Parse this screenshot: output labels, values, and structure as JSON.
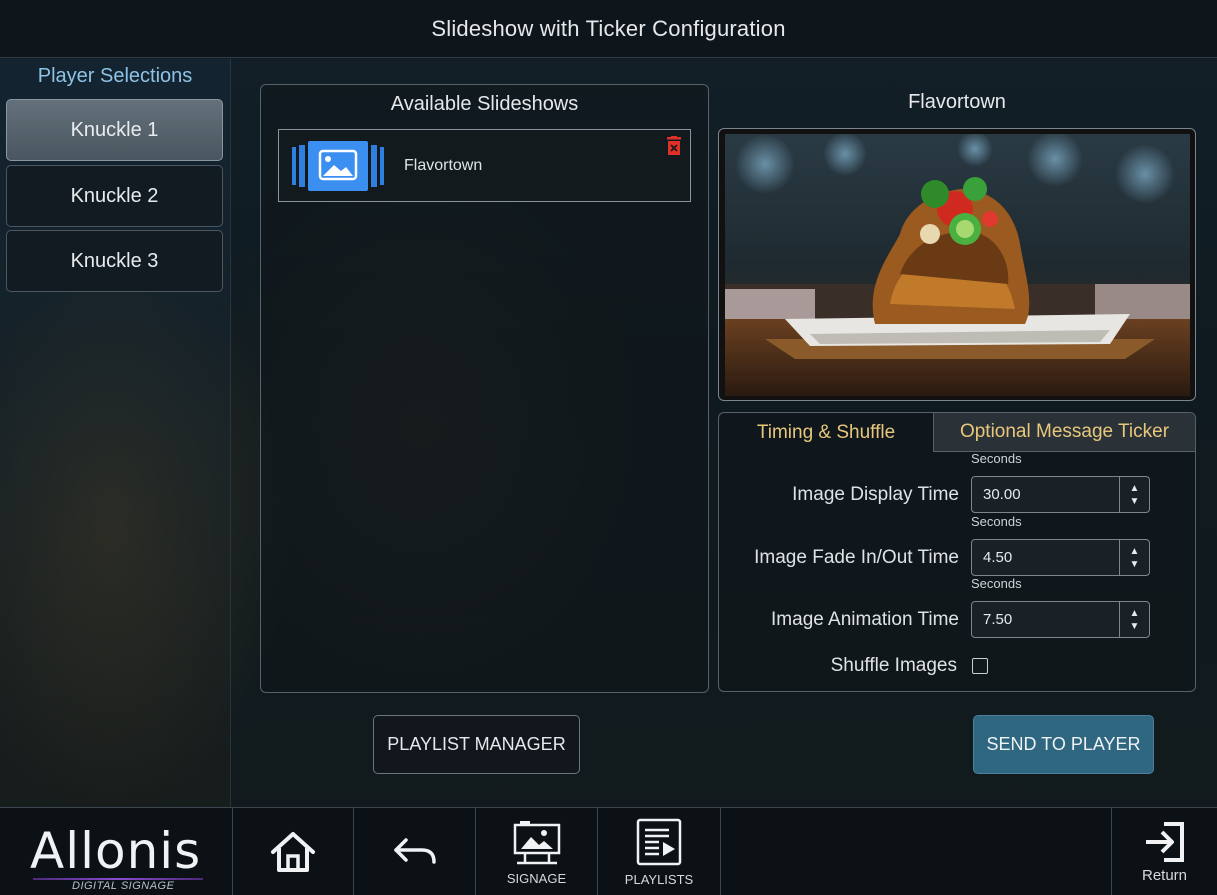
{
  "header": {
    "title": "Slideshow with Ticker Configuration"
  },
  "sidebar": {
    "title": "Player Selections",
    "players": [
      {
        "label": "Knuckle 1",
        "active": true
      },
      {
        "label": "Knuckle 2",
        "active": false
      },
      {
        "label": "Knuckle 3",
        "active": false
      }
    ]
  },
  "slideshows": {
    "title": "Available Slideshows",
    "items": [
      {
        "name": "Flavortown",
        "icon": "slideshow-image-icon",
        "delete_icon": "trash-icon"
      }
    ]
  },
  "preview": {
    "title": "Flavortown",
    "image": "nachos-food-photo"
  },
  "settings": {
    "tabs": [
      {
        "label": "Timing & Shuffle",
        "active": true
      },
      {
        "label": "Optional Message Ticker",
        "active": false
      }
    ],
    "fields": [
      {
        "label": "Image Display Time",
        "unit": "Seconds",
        "value": "30.00"
      },
      {
        "label": "Image Fade In/Out Time",
        "unit": "Seconds",
        "value": "4.50"
      },
      {
        "label": "Image Animation Time",
        "unit": "Seconds",
        "value": "7.50"
      }
    ],
    "shuffle": {
      "label": "Shuffle Images",
      "checked": false
    }
  },
  "actions": {
    "playlist_manager": "PLAYLIST MANAGER",
    "send_to_player": "SEND TO PLAYER"
  },
  "footer": {
    "logo_text": "Allonis",
    "logo_sub": "DIGITAL SIGNAGE",
    "home_icon": "home-icon",
    "back_icon": "back-arrow-icon",
    "signage_label": "SIGNAGE",
    "playlists_label": "PLAYLISTS",
    "return_label": "Return"
  },
  "colors": {
    "accent_blue": "#2f6680",
    "tab_text": "#e8c77c",
    "sidebar_title": "#8ec2e6",
    "delete_red": "#e0302a"
  }
}
